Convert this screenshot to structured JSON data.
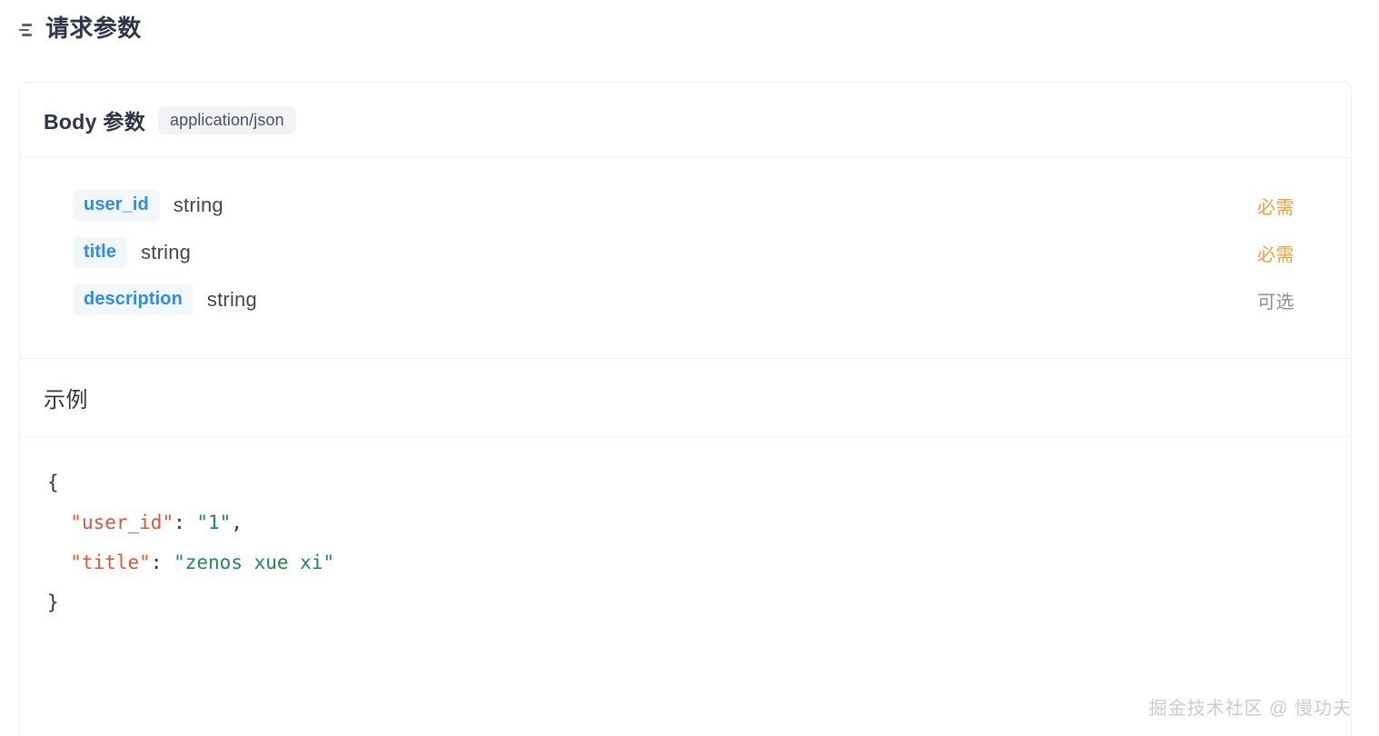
{
  "page": {
    "heading_icon": "list-lines-icon",
    "title": "请求参数"
  },
  "body_section": {
    "title": "Body 参数",
    "content_type": "application/json",
    "params": [
      {
        "name": "user_id",
        "type": "string",
        "requirement": "必需",
        "required": true
      },
      {
        "name": "title",
        "type": "string",
        "requirement": "必需",
        "required": true
      },
      {
        "name": "description",
        "type": "string",
        "requirement": "可选",
        "required": false
      }
    ]
  },
  "example_section": {
    "title": "示例",
    "code_lines": [
      [
        {
          "t": "punct",
          "v": "{"
        }
      ],
      [
        {
          "t": "punct",
          "v": "  "
        },
        {
          "t": "key",
          "v": "\"user_id\""
        },
        {
          "t": "punct",
          "v": ": "
        },
        {
          "t": "str",
          "v": "\"1\""
        },
        {
          "t": "punct",
          "v": ","
        }
      ],
      [
        {
          "t": "punct",
          "v": "  "
        },
        {
          "t": "key",
          "v": "\"title\""
        },
        {
          "t": "punct",
          "v": ": "
        },
        {
          "t": "str",
          "v": "\"zenos xue xi\""
        }
      ],
      [
        {
          "t": "punct",
          "v": "}"
        }
      ]
    ]
  },
  "watermark": {
    "text": "掘金技术社区 @ 慢功夫"
  },
  "colors": {
    "accent_blue": "#2e8bf0",
    "required_orange": "#e9a23b",
    "optional_gray": "#8a8f9c",
    "code_key": "#d9583a",
    "code_string": "#1f8a4c",
    "heading_text": "#30364a",
    "divider": "#f2f3f5"
  }
}
